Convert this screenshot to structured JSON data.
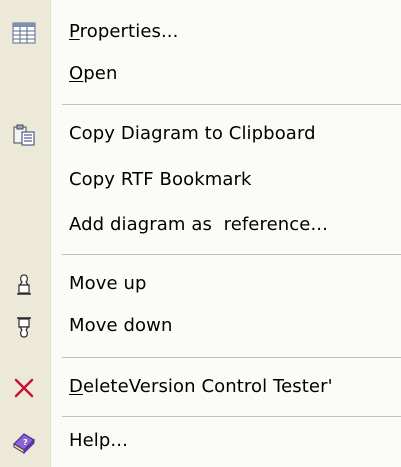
{
  "menu": {
    "items": [
      {
        "id": "properties",
        "prefix": "",
        "mnemonic": "P",
        "rest": "roperties...",
        "icon": "properties-icon"
      },
      {
        "id": "open",
        "prefix": "",
        "mnemonic": "O",
        "rest": "pen",
        "icon": ""
      },
      {
        "id": "copy-diagram",
        "prefix": "",
        "mnemonic": "",
        "rest": "Copy Diagram to Clipboard",
        "icon": "copy-clipboard-icon"
      },
      {
        "id": "copy-rtf",
        "prefix": "",
        "mnemonic": "",
        "rest": "Copy RTF Bookmark",
        "icon": ""
      },
      {
        "id": "add-diagram-reference",
        "prefix": "",
        "mnemonic": "",
        "rest": "Add diagram as  reference...",
        "icon": ""
      },
      {
        "id": "move-up",
        "prefix": "",
        "mnemonic": "",
        "rest": "Move up",
        "icon": "move-up-icon"
      },
      {
        "id": "move-down",
        "prefix": "",
        "mnemonic": "",
        "rest": "Move down",
        "icon": "move-down-icon"
      },
      {
        "id": "delete",
        "prefix": "",
        "mnemonic": "D",
        "rest": "eleteVersion Control Tester'",
        "icon": "delete-icon"
      },
      {
        "id": "help",
        "prefix": "",
        "mnemonic": "",
        "rest": "Help...",
        "icon": "help-book-icon"
      }
    ]
  },
  "colors": {
    "gutter": "#ece9d8",
    "menu_bg": "#fbfbf8",
    "separator": "#c5c2b2",
    "delete_red": "#c8102e",
    "help_purple": "#7b4fc2"
  }
}
